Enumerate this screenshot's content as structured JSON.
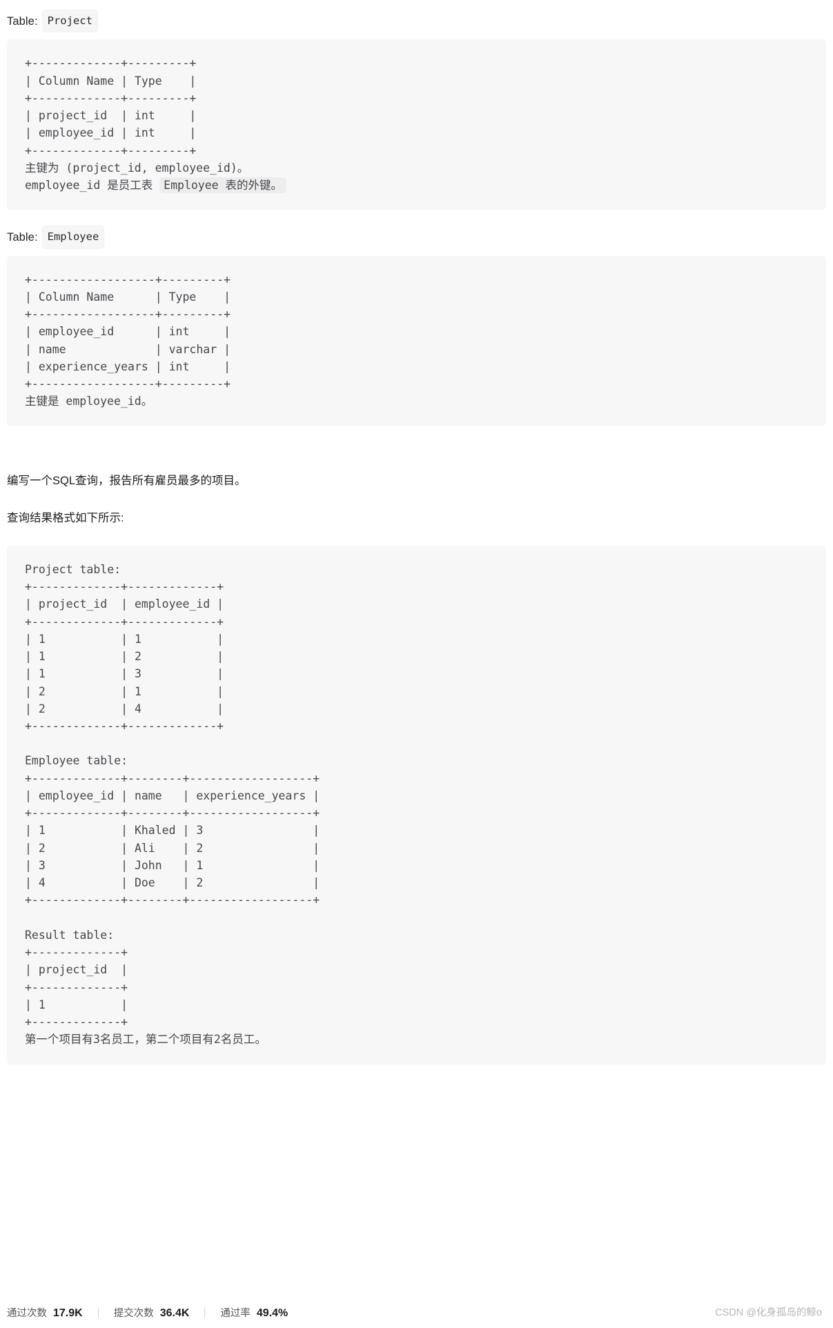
{
  "sections": {
    "project": {
      "label_prefix": "Table:",
      "table_name": "Project",
      "schema_ascii": "+-------------+---------+\n| Column Name | Type    |\n+-------------+---------+\n| project_id  | int     |\n| employee_id | int     |\n+-------------+---------+",
      "note_line1": "主键为 (project_id, employee_id)。",
      "note_line2_before": "employee_id 是员工表 ",
      "note_line2_chip": "Employee 表的外键。"
    },
    "employee": {
      "label_prefix": "Table:",
      "table_name": "Employee",
      "schema_ascii": "+------------------+---------+\n| Column Name      | Type    |\n+------------------+---------+\n| employee_id      | int     |\n| name             | varchar |\n| experience_years | int     |\n+------------------+---------+",
      "note_line1": "主键是 employee_id。"
    }
  },
  "prose": {
    "question": "编写一个SQL查询，报告所有雇员最多的项目。",
    "format_hint": "查询结果格式如下所示:"
  },
  "example": {
    "project_title": "Project table:",
    "project_ascii": "+-------------+-------------+\n| project_id  | employee_id |\n+-------------+-------------+\n| 1           | 1           |\n| 1           | 2           |\n| 1           | 3           |\n| 2           | 1           |\n| 2           | 4           |\n+-------------+-------------+",
    "employee_title": "Employee table:",
    "employee_ascii": "+-------------+--------+------------------+\n| employee_id | name   | experience_years |\n+-------------+--------+------------------+\n| 1           | Khaled | 3                |\n| 2           | Ali    | 2                |\n| 3           | John   | 1                |\n| 4           | Doe    | 2                |\n+-------------+--------+------------------+",
    "result_title": "Result table:",
    "result_ascii": "+-------------+\n| project_id  |\n+-------------+\n| 1           |\n+-------------+",
    "explanation": "第一个项目有3名员工，第二个项目有2名员工。"
  },
  "footer": {
    "stats": [
      {
        "key": "通过次数",
        "value": "17.9K"
      },
      {
        "key": "提交次数",
        "value": "36.4K"
      },
      {
        "key": "通过率",
        "value": "49.4%"
      }
    ],
    "watermark": "CSDN @化身孤岛的鲸o"
  },
  "table_data": {
    "schema_project": {
      "columns": [
        "Column Name",
        "Type"
      ],
      "rows": [
        [
          "project_id",
          "int"
        ],
        [
          "employee_id",
          "int"
        ]
      ]
    },
    "schema_employee": {
      "columns": [
        "Column Name",
        "Type"
      ],
      "rows": [
        [
          "employee_id",
          "int"
        ],
        [
          "name",
          "varchar"
        ],
        [
          "experience_years",
          "int"
        ]
      ]
    },
    "sample_project": {
      "columns": [
        "project_id",
        "employee_id"
      ],
      "rows": [
        [
          "1",
          "1"
        ],
        [
          "1",
          "2"
        ],
        [
          "1",
          "3"
        ],
        [
          "2",
          "1"
        ],
        [
          "2",
          "4"
        ]
      ]
    },
    "sample_employee": {
      "columns": [
        "employee_id",
        "name",
        "experience_years"
      ],
      "rows": [
        [
          "1",
          "Khaled",
          "3"
        ],
        [
          "2",
          "Ali",
          "2"
        ],
        [
          "3",
          "John",
          "1"
        ],
        [
          "4",
          "Doe",
          "2"
        ]
      ]
    },
    "sample_result": {
      "columns": [
        "project_id"
      ],
      "rows": [
        [
          "1"
        ]
      ]
    }
  }
}
